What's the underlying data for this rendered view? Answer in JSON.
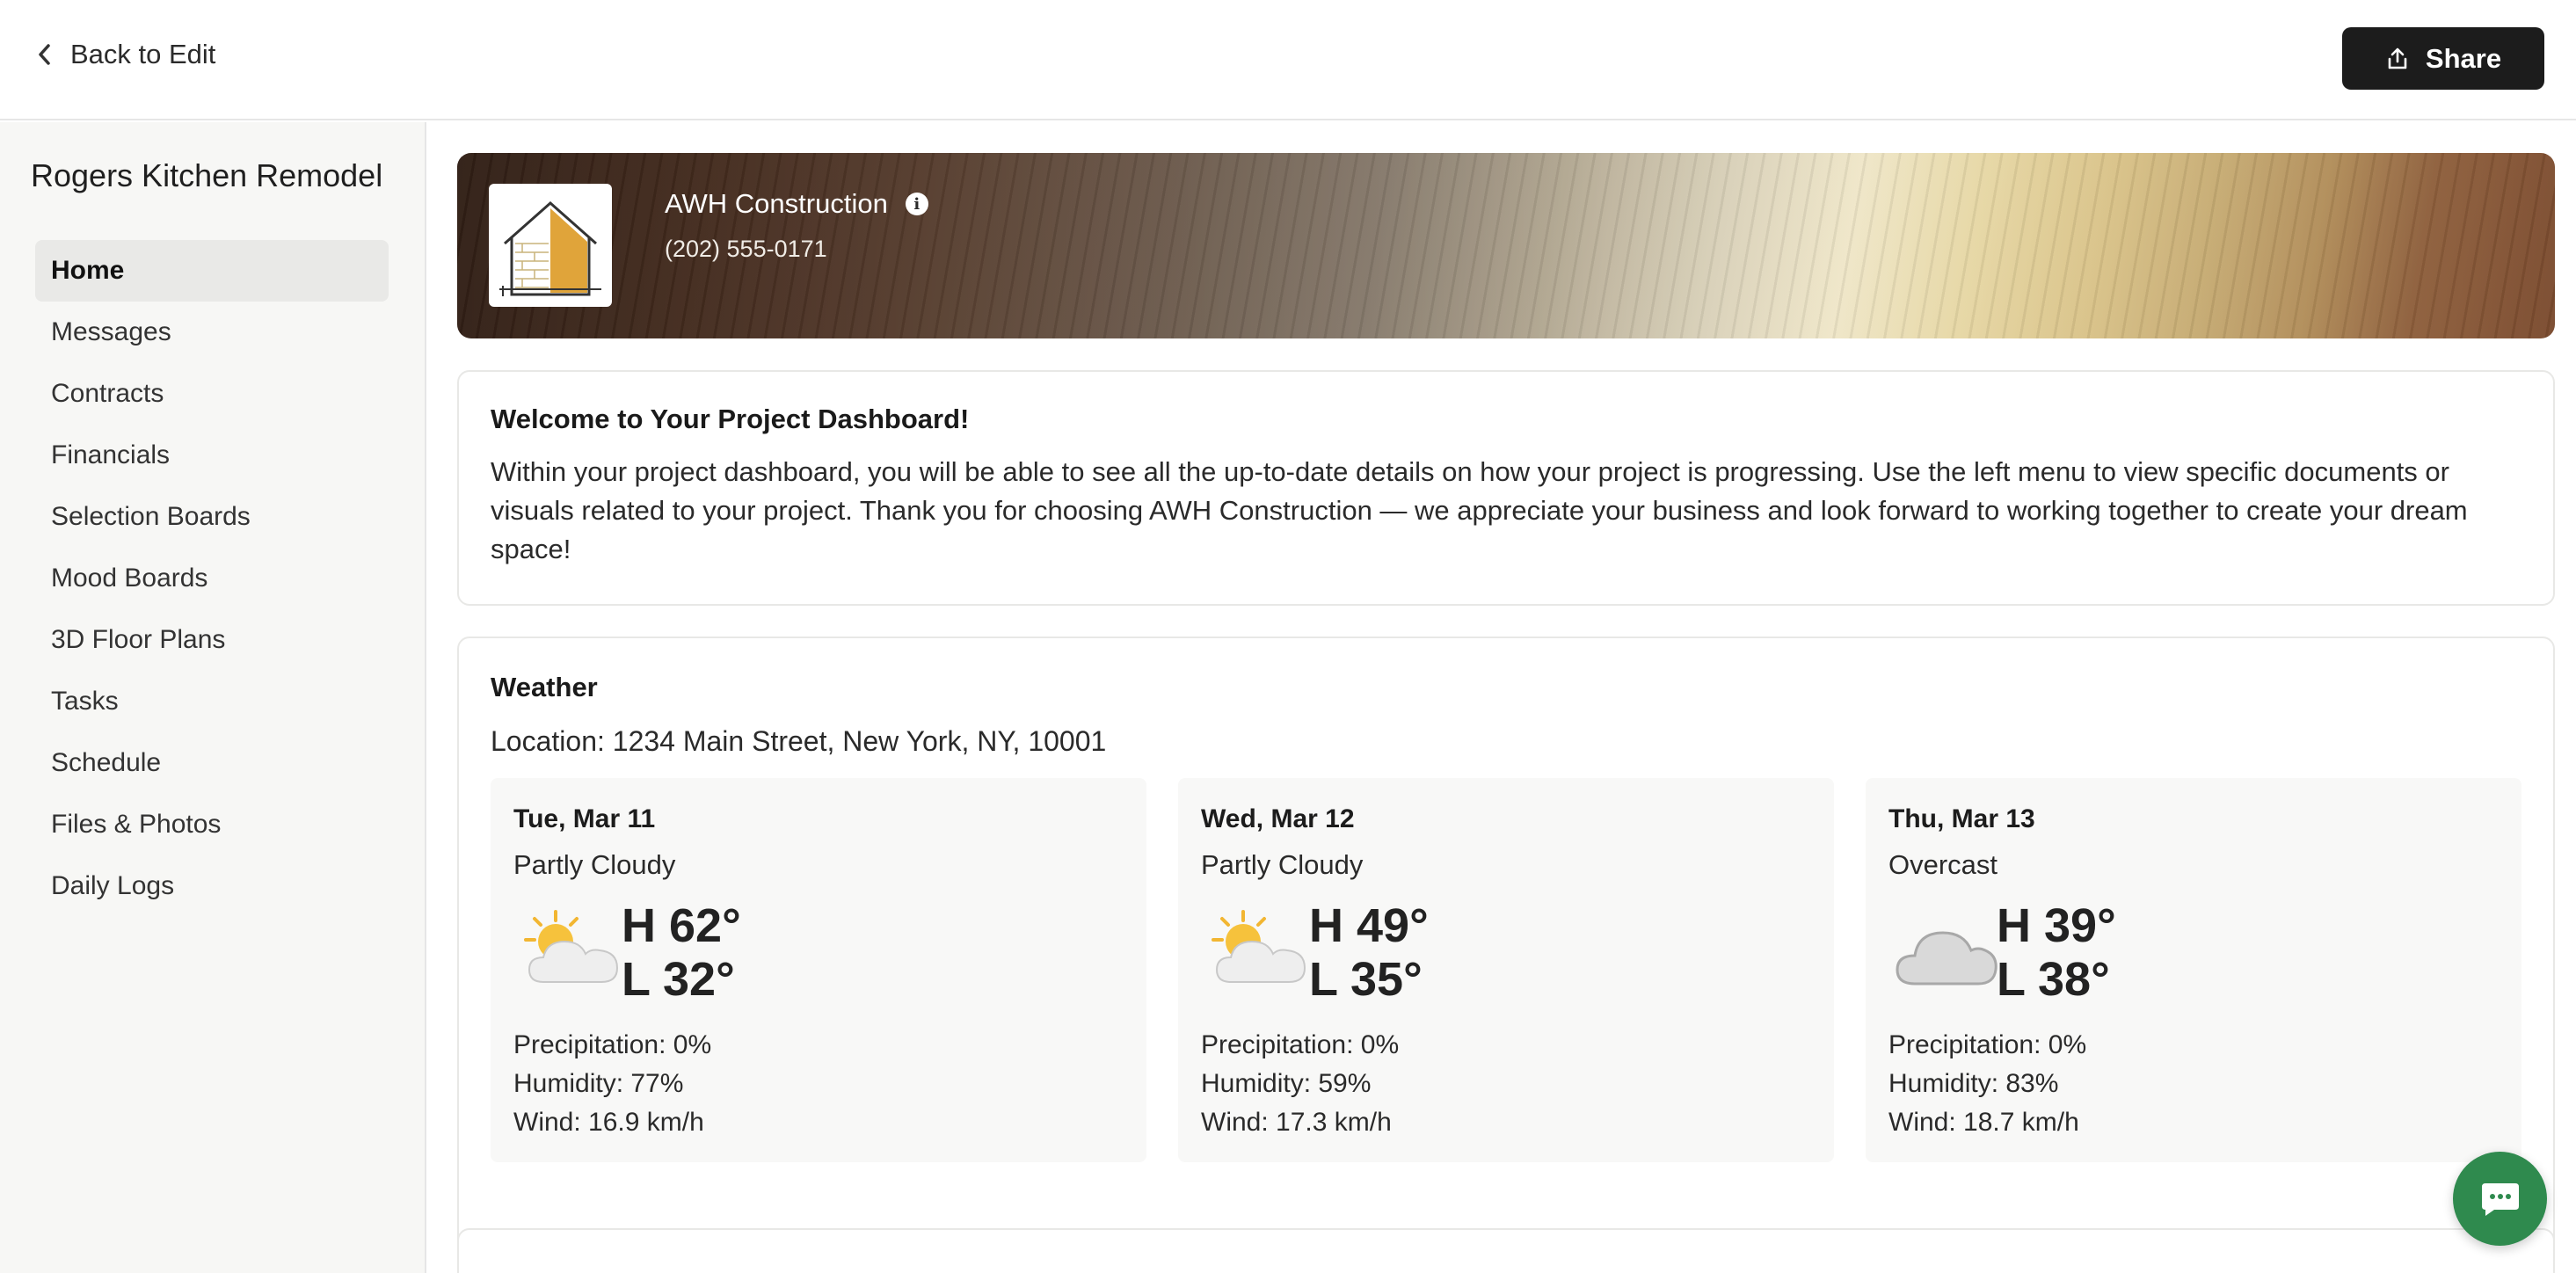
{
  "topbar": {
    "back_label": "Back to Edit",
    "share_label": "Share"
  },
  "sidebar": {
    "project_title": "Rogers Kitchen Remodel",
    "items": [
      {
        "label": "Home",
        "active": true
      },
      {
        "label": "Messages"
      },
      {
        "label": "Contracts"
      },
      {
        "label": "Financials"
      },
      {
        "label": "Selection Boards"
      },
      {
        "label": "Mood Boards"
      },
      {
        "label": "3D Floor Plans"
      },
      {
        "label": "Tasks"
      },
      {
        "label": "Schedule"
      },
      {
        "label": "Files & Photos"
      },
      {
        "label": "Daily Logs"
      }
    ]
  },
  "company": {
    "name": "AWH Construction",
    "phone": "(202) 555-0171"
  },
  "welcome": {
    "title": "Welcome to Your Project Dashboard!",
    "body": "Within your project dashboard, you will be able to see all the up-to-date details on how your project is progressing. Use the left menu to view specific documents or visuals related to your project. Thank you for choosing AWH Construction — we appreciate your business and look forward to working together to create your dream space!"
  },
  "weather": {
    "title": "Weather",
    "location": "Location: 1234 Main Street, New York, NY, 10001",
    "days": [
      {
        "date": "Tue, Mar 11",
        "condition": "Partly Cloudy",
        "icon": "partly-cloudy-icon",
        "high": "H 62°",
        "low": "L 32°",
        "precipitation": "Precipitation: 0%",
        "humidity": "Humidity: 77%",
        "wind": "Wind: 16.9 km/h"
      },
      {
        "date": "Wed, Mar 12",
        "condition": "Partly Cloudy",
        "icon": "partly-cloudy-icon",
        "high": "H 49°",
        "low": "L 35°",
        "precipitation": "Precipitation: 0%",
        "humidity": "Humidity: 59%",
        "wind": "Wind: 17.3 km/h"
      },
      {
        "date": "Thu, Mar 13",
        "condition": "Overcast",
        "icon": "overcast-icon",
        "high": "H 39°",
        "low": "L 38°",
        "precipitation": "Precipitation: 0%",
        "humidity": "Humidity: 83%",
        "wind": "Wind: 18.7 km/h"
      }
    ]
  },
  "colors": {
    "share_bg": "#1c1c1c",
    "chat_bg": "#2f8a4e",
    "sidebar_bg": "#f7f7f5",
    "active_nav_bg": "#e9e9e7"
  }
}
